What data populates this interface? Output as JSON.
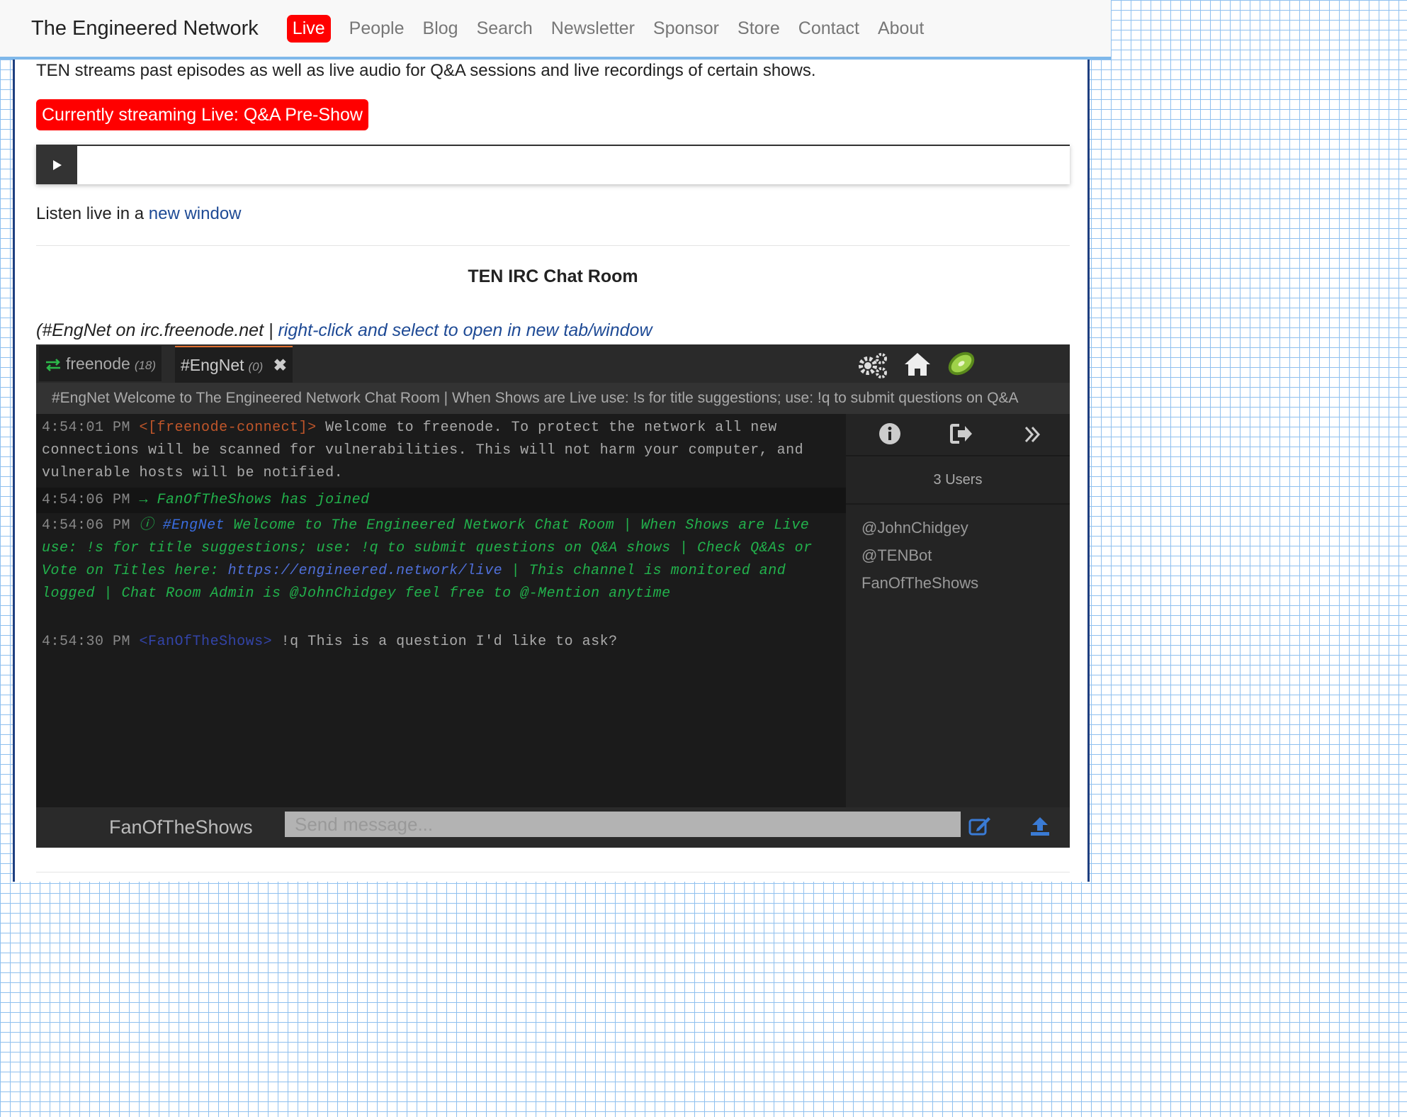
{
  "nav": {
    "brand": "The Engineered Network",
    "links": [
      {
        "label": "Live"
      },
      {
        "label": "People"
      },
      {
        "label": "Blog"
      },
      {
        "label": "Search"
      },
      {
        "label": "Newsletter"
      },
      {
        "label": "Sponsor"
      },
      {
        "label": "Store"
      },
      {
        "label": "Contact"
      },
      {
        "label": "About"
      }
    ]
  },
  "page": {
    "intro": "TEN streams past episodes as well as live audio for Q&A sessions and live recordings of certain shows.",
    "streaming_badge": "Currently streaming Live: Q&A Pre-Show",
    "listen_prefix": "Listen live in a",
    "listen_link": "new window",
    "irc_title": "TEN IRC Chat Room",
    "irc_sub_prefix": "(#EngNet on irc.freenode.net |",
    "irc_sub_link": "right-click and select to open in new tab/window"
  },
  "chat": {
    "tabs": [
      {
        "name": "freenode",
        "count": "(18)"
      },
      {
        "name": "#EngNet",
        "count": "(0)"
      }
    ],
    "topic": "#EngNet Welcome to The Engineered Network Chat Room | When Shows are Live use: !s for title suggestions; use: !q to submit questions on Q&A",
    "messages": [
      {
        "time": "4:54:01 PM",
        "nick": "<[freenode-connect]>",
        "text": "Welcome to freenode. To protect the network all new connections will be scanned for vulnerabilities. This will not harm your computer, and vulnerable hosts will be notified."
      },
      {
        "time": "4:54:06 PM",
        "text": "→ FanOfTheShows has joined"
      },
      {
        "time": "4:54:06 PM",
        "channel": "#EngNet",
        "text_before_url": "Welcome to The Engineered Network Chat Room | When Shows are Live use: !s for title suggestions; use: !q to submit questions on Q&A shows | Check Q&As or Vote on Titles here:",
        "url": "https://engineered.network/live",
        "text_after_url": "| This channel is monitored and logged | Chat Room Admin is @JohnChidgey feel free to @-Mention anytime"
      },
      {
        "time": "4:54:30 PM",
        "nick": "<FanOfTheShows>",
        "text": "!q This is a question I'd like to ask?"
      }
    ],
    "users_count": "3 Users",
    "users": [
      "@JohnChidgey",
      "@TENBot",
      "FanOfTheShows"
    ],
    "current_nick": "FanOfTheShows",
    "send_placeholder": "Send message...",
    "icons": {
      "settings": "gears-icon",
      "home": "home-icon",
      "logo": "kiwi-icon",
      "info": "info-icon",
      "part": "leave-channel-icon",
      "collapse": "double-chevron-right-icon",
      "compose": "compose-icon",
      "upload": "upload-icon"
    }
  }
}
